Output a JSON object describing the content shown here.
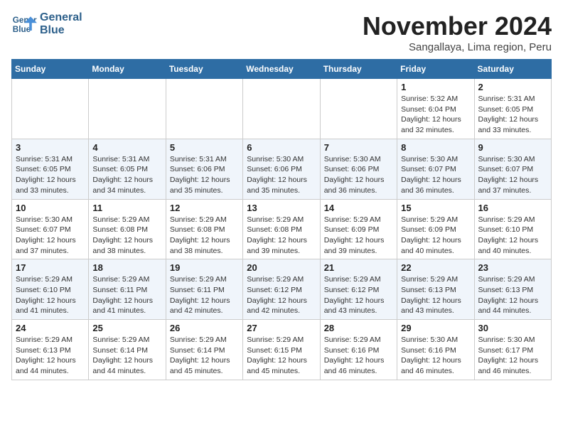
{
  "logo": {
    "line1": "General",
    "line2": "Blue"
  },
  "header": {
    "month": "November 2024",
    "location": "Sangallaya, Lima region, Peru"
  },
  "weekdays": [
    "Sunday",
    "Monday",
    "Tuesday",
    "Wednesday",
    "Thursday",
    "Friday",
    "Saturday"
  ],
  "weeks": [
    [
      {
        "day": "",
        "text": ""
      },
      {
        "day": "",
        "text": ""
      },
      {
        "day": "",
        "text": ""
      },
      {
        "day": "",
        "text": ""
      },
      {
        "day": "",
        "text": ""
      },
      {
        "day": "1",
        "text": "Sunrise: 5:32 AM\nSunset: 6:04 PM\nDaylight: 12 hours and 32 minutes."
      },
      {
        "day": "2",
        "text": "Sunrise: 5:31 AM\nSunset: 6:05 PM\nDaylight: 12 hours and 33 minutes."
      }
    ],
    [
      {
        "day": "3",
        "text": "Sunrise: 5:31 AM\nSunset: 6:05 PM\nDaylight: 12 hours and 33 minutes."
      },
      {
        "day": "4",
        "text": "Sunrise: 5:31 AM\nSunset: 6:05 PM\nDaylight: 12 hours and 34 minutes."
      },
      {
        "day": "5",
        "text": "Sunrise: 5:31 AM\nSunset: 6:06 PM\nDaylight: 12 hours and 35 minutes."
      },
      {
        "day": "6",
        "text": "Sunrise: 5:30 AM\nSunset: 6:06 PM\nDaylight: 12 hours and 35 minutes."
      },
      {
        "day": "7",
        "text": "Sunrise: 5:30 AM\nSunset: 6:06 PM\nDaylight: 12 hours and 36 minutes."
      },
      {
        "day": "8",
        "text": "Sunrise: 5:30 AM\nSunset: 6:07 PM\nDaylight: 12 hours and 36 minutes."
      },
      {
        "day": "9",
        "text": "Sunrise: 5:30 AM\nSunset: 6:07 PM\nDaylight: 12 hours and 37 minutes."
      }
    ],
    [
      {
        "day": "10",
        "text": "Sunrise: 5:30 AM\nSunset: 6:07 PM\nDaylight: 12 hours and 37 minutes."
      },
      {
        "day": "11",
        "text": "Sunrise: 5:29 AM\nSunset: 6:08 PM\nDaylight: 12 hours and 38 minutes."
      },
      {
        "day": "12",
        "text": "Sunrise: 5:29 AM\nSunset: 6:08 PM\nDaylight: 12 hours and 38 minutes."
      },
      {
        "day": "13",
        "text": "Sunrise: 5:29 AM\nSunset: 6:08 PM\nDaylight: 12 hours and 39 minutes."
      },
      {
        "day": "14",
        "text": "Sunrise: 5:29 AM\nSunset: 6:09 PM\nDaylight: 12 hours and 39 minutes."
      },
      {
        "day": "15",
        "text": "Sunrise: 5:29 AM\nSunset: 6:09 PM\nDaylight: 12 hours and 40 minutes."
      },
      {
        "day": "16",
        "text": "Sunrise: 5:29 AM\nSunset: 6:10 PM\nDaylight: 12 hours and 40 minutes."
      }
    ],
    [
      {
        "day": "17",
        "text": "Sunrise: 5:29 AM\nSunset: 6:10 PM\nDaylight: 12 hours and 41 minutes."
      },
      {
        "day": "18",
        "text": "Sunrise: 5:29 AM\nSunset: 6:11 PM\nDaylight: 12 hours and 41 minutes."
      },
      {
        "day": "19",
        "text": "Sunrise: 5:29 AM\nSunset: 6:11 PM\nDaylight: 12 hours and 42 minutes."
      },
      {
        "day": "20",
        "text": "Sunrise: 5:29 AM\nSunset: 6:12 PM\nDaylight: 12 hours and 42 minutes."
      },
      {
        "day": "21",
        "text": "Sunrise: 5:29 AM\nSunset: 6:12 PM\nDaylight: 12 hours and 43 minutes."
      },
      {
        "day": "22",
        "text": "Sunrise: 5:29 AM\nSunset: 6:13 PM\nDaylight: 12 hours and 43 minutes."
      },
      {
        "day": "23",
        "text": "Sunrise: 5:29 AM\nSunset: 6:13 PM\nDaylight: 12 hours and 44 minutes."
      }
    ],
    [
      {
        "day": "24",
        "text": "Sunrise: 5:29 AM\nSunset: 6:13 PM\nDaylight: 12 hours and 44 minutes."
      },
      {
        "day": "25",
        "text": "Sunrise: 5:29 AM\nSunset: 6:14 PM\nDaylight: 12 hours and 44 minutes."
      },
      {
        "day": "26",
        "text": "Sunrise: 5:29 AM\nSunset: 6:14 PM\nDaylight: 12 hours and 45 minutes."
      },
      {
        "day": "27",
        "text": "Sunrise: 5:29 AM\nSunset: 6:15 PM\nDaylight: 12 hours and 45 minutes."
      },
      {
        "day": "28",
        "text": "Sunrise: 5:29 AM\nSunset: 6:16 PM\nDaylight: 12 hours and 46 minutes."
      },
      {
        "day": "29",
        "text": "Sunrise: 5:30 AM\nSunset: 6:16 PM\nDaylight: 12 hours and 46 minutes."
      },
      {
        "day": "30",
        "text": "Sunrise: 5:30 AM\nSunset: 6:17 PM\nDaylight: 12 hours and 46 minutes."
      }
    ]
  ]
}
